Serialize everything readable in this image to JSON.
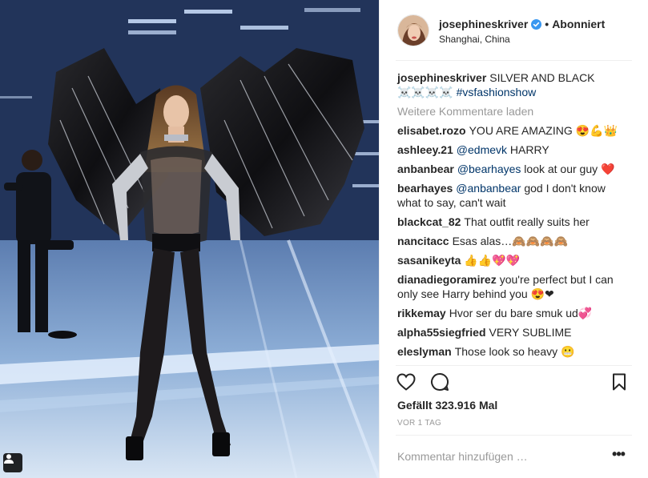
{
  "post": {
    "username": "josephineskriver",
    "follow_status": "Abonniert",
    "location": "Shanghai, China",
    "verified": true,
    "caption_user": "josephineskriver",
    "caption_text": "SILVER AND BLACK ☠️☠️☠️☠️",
    "caption_hashtag": "#vsfashionshow",
    "load_more": "Weitere Kommentare laden"
  },
  "comments": [
    {
      "user": "elisabet.rozo",
      "text": "YOU ARE AMAZING 😍💪👑"
    },
    {
      "user": "ashleey.21",
      "mention": "@edmevk",
      "text": " HARRY"
    },
    {
      "user": "anbanbear",
      "mention": "@bearhayes",
      "text": " look at our guy ❤️"
    },
    {
      "user": "bearhayes",
      "mention": "@anbanbear",
      "text": " god I don't know what to say, can't wait"
    },
    {
      "user": "blackcat_82",
      "text": "That outfit really suits her"
    },
    {
      "user": "nancitacc",
      "text": "Esas alas…🙈🙈🙈🙈"
    },
    {
      "user": "sasanikeyta",
      "text": "👍👍💖💖"
    },
    {
      "user": "dianadiegoramirez",
      "text": "you're perfect but I can only see Harry behind you 😍❤"
    },
    {
      "user": "rikkemay",
      "text": "Hvor ser du bare smuk ud💞"
    },
    {
      "user": "alpha55siegfried",
      "text": "VERY SUBLIME"
    },
    {
      "user": "eleslyman",
      "text": "Those look so heavy 😬"
    }
  ],
  "stats": {
    "likes": "Gefällt 323.916 Mal",
    "time": "VOR 1 TAG"
  },
  "composer": {
    "placeholder": "Kommentar hinzufügen …",
    "more_label": "•••"
  },
  "icons": {
    "like": "heart-icon",
    "comment": "comment-bubble-icon",
    "save": "bookmark-icon",
    "tag": "user-tag-icon",
    "verified": "verified-badge-icon"
  },
  "colors": {
    "text": "#262626",
    "muted": "#999999",
    "link": "#003569",
    "verified": "#3897f0",
    "divider": "#efefef"
  }
}
